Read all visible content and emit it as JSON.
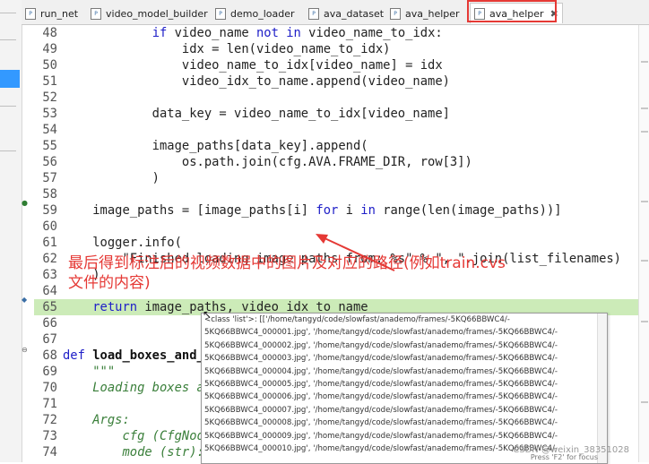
{
  "tabs": [
    {
      "label": "run_net",
      "active": false
    },
    {
      "label": "video_model_builder",
      "active": false
    },
    {
      "label": "demo_loader",
      "active": false
    },
    {
      "label": "ava_dataset",
      "active": false
    },
    {
      "label": "ava_helper",
      "active": false
    },
    {
      "label": "ava_helper",
      "active": true,
      "close": "✖"
    }
  ],
  "code_lines": [
    {
      "num": "48",
      "text": "            if video_name not in video_name_to_idx:"
    },
    {
      "num": "49",
      "text": "                idx = len(video_name_to_idx)"
    },
    {
      "num": "50",
      "text": "                video_name_to_idx[video_name] = idx"
    },
    {
      "num": "51",
      "text": "                video_idx_to_name.append(video_name)"
    },
    {
      "num": "52",
      "text": ""
    },
    {
      "num": "53",
      "text": "            data_key = video_name_to_idx[video_name]"
    },
    {
      "num": "54",
      "text": ""
    },
    {
      "num": "55",
      "text": "            image_paths[data_key].append("
    },
    {
      "num": "56",
      "text": "                os.path.join(cfg.AVA.FRAME_DIR, row[3])"
    },
    {
      "num": "57",
      "text": "            )"
    },
    {
      "num": "58",
      "text": ""
    },
    {
      "num": "59",
      "text": "    image_paths = [image_paths[i] for i in range(len(image_paths))]"
    },
    {
      "num": "60",
      "text": ""
    },
    {
      "num": "61",
      "text": "    logger.info("
    },
    {
      "num": "62",
      "text": "        \"Finished loading image paths from: %s\" % \", \".join(list_filenames)"
    },
    {
      "num": "63",
      "text": "    )"
    },
    {
      "num": "64",
      "text": ""
    },
    {
      "num": "65",
      "text": "    return image_paths, video_idx_to_name"
    },
    {
      "num": "66",
      "text": ""
    },
    {
      "num": "67",
      "text": ""
    },
    {
      "num": "68",
      "text": "def load_boxes_and_labels(cfg, mode):"
    },
    {
      "num": "69",
      "text": "    \"\"\""
    },
    {
      "num": "70",
      "text": "    Loading boxes and labels from csv files."
    },
    {
      "num": "71",
      "text": ""
    },
    {
      "num": "72",
      "text": "    Args:"
    },
    {
      "num": "73",
      "text": "        cfg (CfgNode): config."
    },
    {
      "num": "74",
      "text": "        mode (str): 'train', 'val', or 'test' mode."
    }
  ],
  "annotation": {
    "line1": "最后得到标注后的视频数据中的图片及对应的路径(例如train.cvs",
    "line2": "文件的内容)"
  },
  "tooltip": {
    "lines": [
      "<class 'list'>: [['/home/tangyd/code/slowfast/anademo/frames/-5KQ66BBWC4/-",
      "5KQ66BBWC4_000001.jpg', '/home/tangyd/code/slowfast/anademo/frames/-5KQ66BBWC4/-",
      "5KQ66BBWC4_000002.jpg', '/home/tangyd/code/slowfast/anademo/frames/-5KQ66BBWC4/-",
      "5KQ66BBWC4_000003.jpg', '/home/tangyd/code/slowfast/anademo/frames/-5KQ66BBWC4/-",
      "5KQ66BBWC4_000004.jpg', '/home/tangyd/code/slowfast/anademo/frames/-5KQ66BBWC4/-",
      "5KQ66BBWC4_000005.jpg', '/home/tangyd/code/slowfast/anademo/frames/-5KQ66BBWC4/-",
      "5KQ66BBWC4_000006.jpg', '/home/tangyd/code/slowfast/anademo/frames/-5KQ66BBWC4/-",
      "5KQ66BBWC4_000007.jpg', '/home/tangyd/code/slowfast/anademo/frames/-5KQ66BBWC4/-",
      "5KQ66BBWC4_000008.jpg', '/home/tangyd/code/slowfast/anademo/frames/-5KQ66BBWC4/-",
      "5KQ66BBWC4_000009.jpg', '/home/tangyd/code/slowfast/anademo/frames/-5KQ66BBWC4/-",
      "5KQ66BBWC4_000010.jpg', '/home/tangyd/code/slowfast/anademo/frames/-5KQ66BBWC4/-"
    ],
    "footer": "Press 'F2' for focus"
  },
  "watermark": "CSDN @weixin_38351028"
}
